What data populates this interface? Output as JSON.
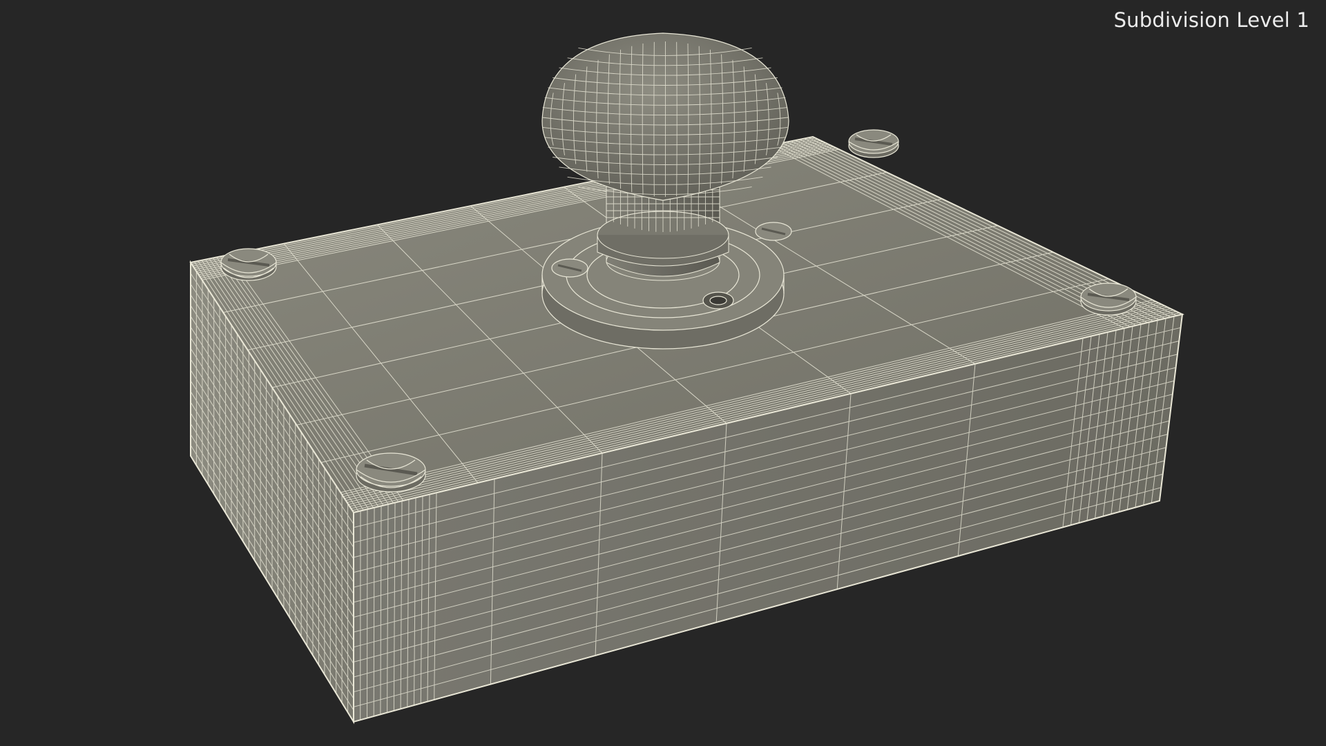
{
  "viewport": {
    "subdivision_label": "Subdivision Level 1",
    "background_color": "#262626",
    "mesh_fill_top": "#7d7c72",
    "mesh_fill_side": "#6f6e65",
    "wire_color": "#e8e6d6",
    "icons": [
      "3d-box-model",
      "mushroom-button-knob",
      "screw-heads",
      "wireframe-mesh"
    ]
  }
}
